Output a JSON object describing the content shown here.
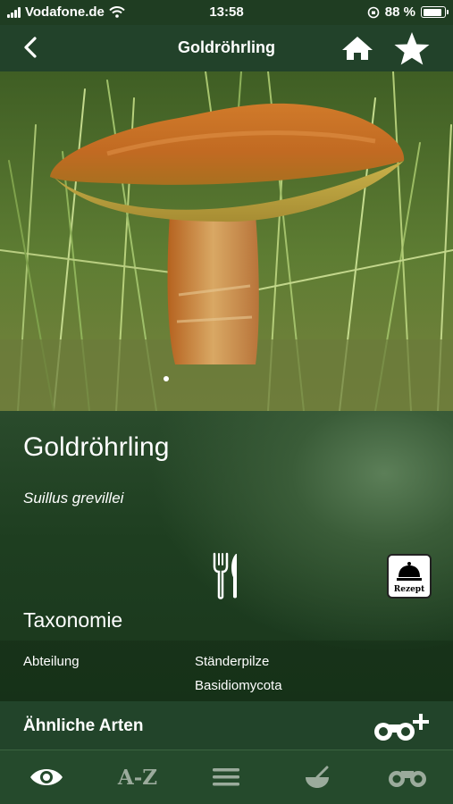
{
  "status_bar": {
    "carrier": "Vodafone.de",
    "time": "13:58",
    "battery_text": "88 %",
    "battery_level": 0.88
  },
  "nav": {
    "title": "Goldröhrling",
    "back_icon": "chevron-left-icon",
    "home_icon": "home-icon",
    "favorite_icon": "star-icon"
  },
  "species": {
    "name": "Goldröhrling",
    "latin_name": "Suillus grevillei",
    "edibility_icon": "cutlery-icon",
    "recipe_label": "Rezept"
  },
  "taxonomy": {
    "title": "Taxonomie",
    "rows": [
      {
        "label": "Abteilung",
        "values": [
          "Ständerpilze",
          "Basidiomycota"
        ]
      }
    ]
  },
  "similar": {
    "label": "Ähnliche Arten",
    "icon": "binoculars-plus-icon"
  },
  "tabs": [
    {
      "name": "tab-overview",
      "icon": "eye-icon",
      "active": true
    },
    {
      "name": "tab-az",
      "label": "A-Z",
      "active": false
    },
    {
      "name": "tab-list",
      "icon": "list-icon",
      "active": false
    },
    {
      "name": "tab-recipes",
      "icon": "bowl-icon",
      "active": false
    },
    {
      "name": "tab-observations",
      "icon": "binoculars-icon",
      "active": false
    }
  ],
  "colors": {
    "bar_green": "#22422a",
    "inactive_icon": "#9bab9c"
  }
}
